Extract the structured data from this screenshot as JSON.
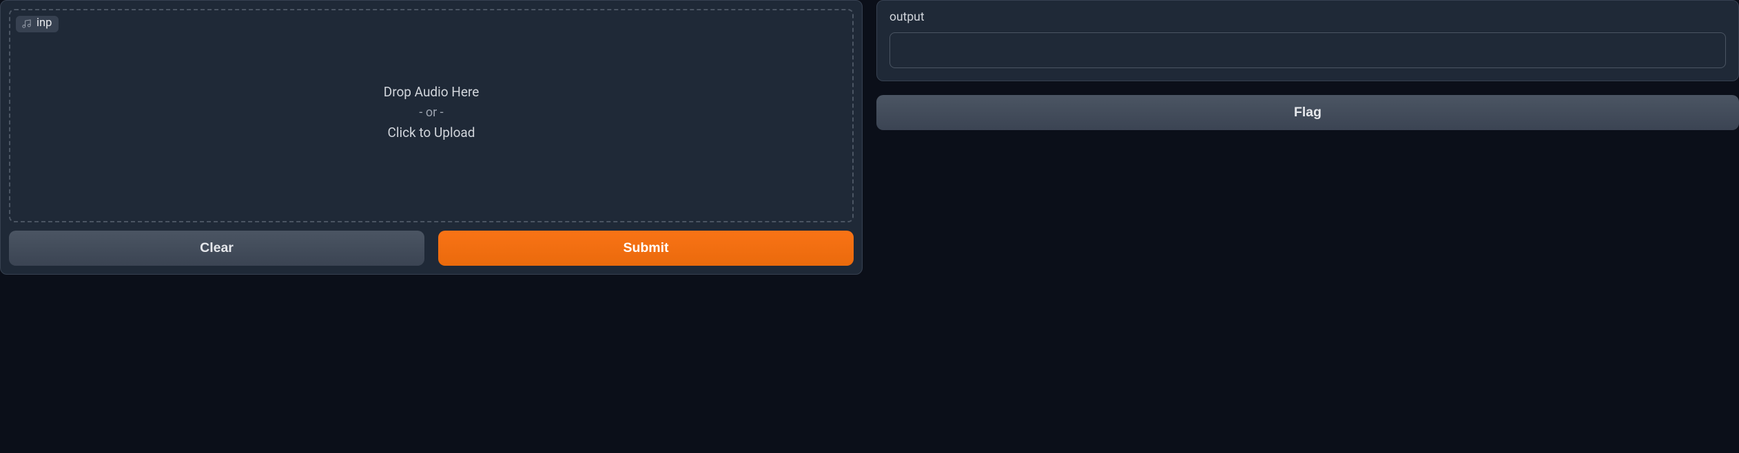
{
  "input": {
    "badge_label": "inp",
    "badge_icon": "music-note-icon",
    "drop_text": "Drop Audio Here",
    "or_text": "- or -",
    "click_text": "Click to Upload"
  },
  "buttons": {
    "clear_label": "Clear",
    "submit_label": "Submit"
  },
  "output": {
    "label": "output",
    "value": ""
  },
  "flag": {
    "label": "Flag"
  },
  "colors": {
    "background": "#0b0f19",
    "panel": "#1f2937",
    "border": "#374151",
    "accent": "#f97316",
    "secondary": "#4b5563",
    "text": "#d1d5db"
  }
}
